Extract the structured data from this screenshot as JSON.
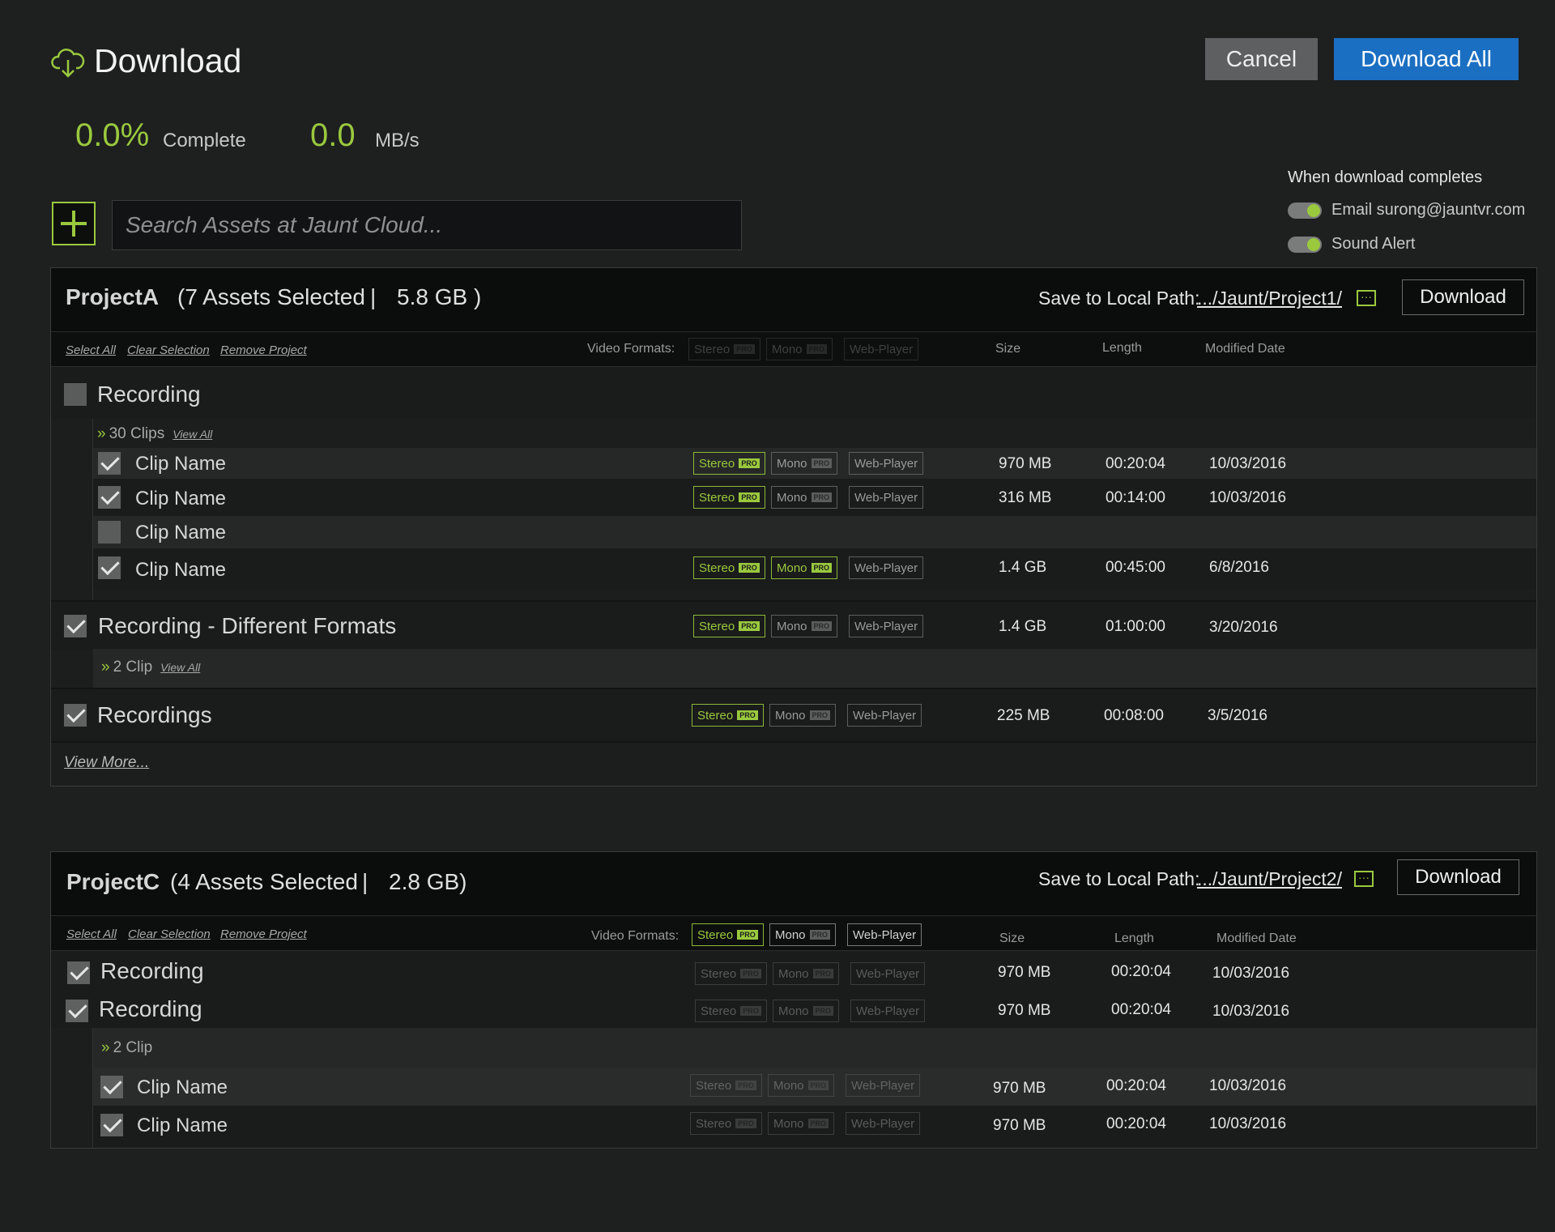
{
  "header": {
    "title": "Download",
    "cancel_label": "Cancel",
    "download_all_label": "Download All"
  },
  "stats": {
    "percent": "0.0%",
    "percent_label": "Complete",
    "rate": "0.0",
    "rate_unit": "MB/s"
  },
  "notify": {
    "title": "When download completes",
    "email_label": "Email surong@jauntvr.com",
    "sound_label": "Sound Alert"
  },
  "search": {
    "placeholder": "Search Assets at Jaunt Cloud..."
  },
  "common": {
    "select_all": "Select All",
    "clear_selection": "Clear Selection",
    "remove_project": "Remove Project",
    "video_formats": "Video Formats:",
    "col_size": "Size",
    "col_length": "Length",
    "col_modified": "Modified Date",
    "save_label": "Save to Local Path:",
    "download_label": "Download",
    "fmt_stereo": "Stereo",
    "fmt_mono": "Mono",
    "fmt_web": "Web-Player",
    "pro": "PRO",
    "view_all": "View All",
    "view_more": "View More..."
  },
  "projectA": {
    "name": "ProjectA",
    "assets": "(7 Assets Selected",
    "sep": "|",
    "size": "5.8 GB )",
    "path": ".../Jaunt/Project1/",
    "group1": {
      "name": "Recording",
      "clips_count": "30 Clips",
      "clips": [
        {
          "name": "Clip Name",
          "size": "970 MB",
          "length": "00:20:04",
          "date": "10/03/2016"
        },
        {
          "name": "Clip Name",
          "size": "316 MB",
          "length": "00:14:00",
          "date": "10/03/2016"
        },
        {
          "name": "Clip Name"
        },
        {
          "name": "Clip Name",
          "size": "1.4 GB",
          "length": "00:45:00",
          "date": "6/8/2016"
        }
      ]
    },
    "group2": {
      "name": "Recording - Different Formats",
      "size": "1.4 GB",
      "length": "01:00:00",
      "date": "3/20/2016",
      "clips_count": "2 Clip"
    },
    "group3": {
      "name": "Recordings",
      "size": "225 MB",
      "length": "00:08:00",
      "date": "3/5/2016"
    }
  },
  "projectC": {
    "name": "ProjectC",
    "assets": "(4 Assets Selected",
    "sep": "|",
    "size": "2.8 GB)",
    "path": ".../Jaunt/Project2/",
    "rows": [
      {
        "name": "Recording",
        "size": "970 MB",
        "length": "00:20:04",
        "date": "10/03/2016"
      },
      {
        "name": "Recording",
        "size": "970 MB",
        "length": "00:20:04",
        "date": "10/03/2016"
      }
    ],
    "clips_count": "2 Clip",
    "clips": [
      {
        "name": "Clip Name",
        "size": "970 MB",
        "length": "00:20:04",
        "date": "10/03/2016"
      },
      {
        "name": "Clip Name",
        "size": "970 MB",
        "length": "00:20:04",
        "date": "10/03/2016"
      }
    ]
  }
}
